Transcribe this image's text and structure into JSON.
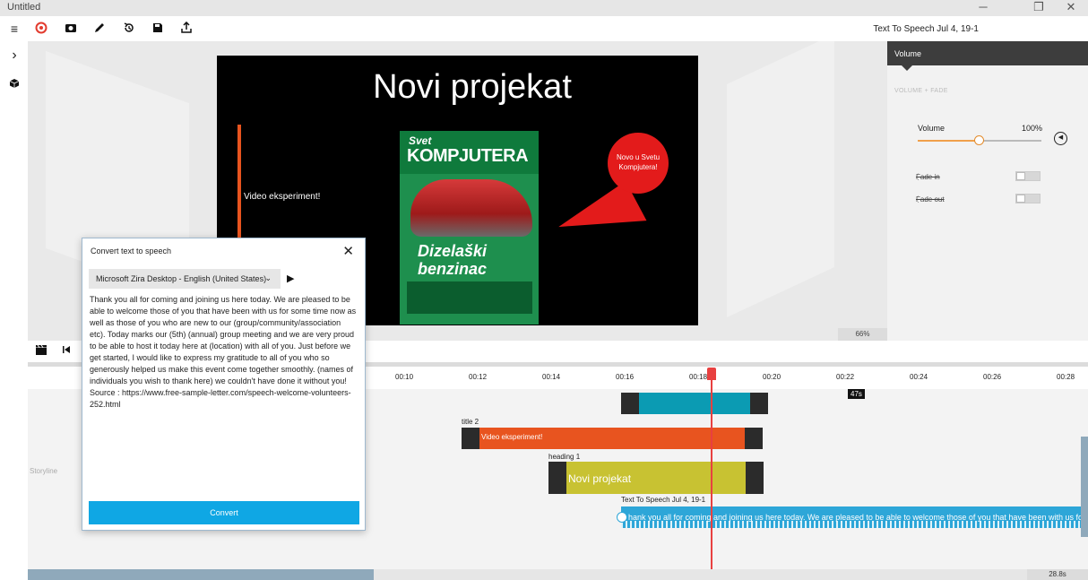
{
  "window": {
    "title": "Untitled",
    "minimize_glyph": "─",
    "restore_glyph": "❐",
    "close_glyph": "✕"
  },
  "toolbar": {
    "document_label": "Text To Speech Jul 4, 19-1",
    "icons": [
      "menu-icon",
      "record-icon",
      "camera-icon",
      "pen-icon",
      "history-icon",
      "save-icon",
      "export-icon"
    ]
  },
  "slide": {
    "title": "Novi projekat",
    "subtitle": "Video eksperiment!",
    "bubble_text": "Novo u Svetu Kompjutera!",
    "magazine": {
      "brand_small": "Svet",
      "brand_big": "KOMPJUTERA",
      "headline_1": "Dizelaški",
      "headline_2": "benzinac"
    },
    "zoom": "66%"
  },
  "properties": {
    "panel_title": "Volume",
    "section": "VOLUME + FADE",
    "volume_label": "Volume",
    "volume_value": "100%",
    "volume_level": 0.5,
    "fade_in_label": "Fade in",
    "fade_out_label": "Fade out"
  },
  "timeline": {
    "ticks": [
      "00:10",
      "00:12",
      "00:14",
      "00:16",
      "00:18",
      "00:20",
      "00:22",
      "00:24",
      "00:26",
      "00:28"
    ],
    "badge": "47s",
    "storyline_label": "Storyline",
    "clips": {
      "title2_label": "title 2",
      "title2_text": "Video eksperiment!",
      "heading1_label": "heading 1",
      "heading1_text": "Novi projekat",
      "tts_label": "Text To Speech Jul 4, 19-1",
      "tts_text": "hank you all for coming and joining us here today. We are pleased to be able to welcome those of you that have been with us for some time"
    },
    "duration": "28.8s"
  },
  "dialog": {
    "title": "Convert text to speech",
    "close_glyph": "✕",
    "voice": "Microsoft Zira Desktop - English (United States)",
    "text": "Thank you all for coming and joining us here today. We are pleased to be able to welcome those of you that have been with us for some time now as well as those of you who are new to our (group/community/association etc). Today marks our (5th) (annual) group meeting and we are very proud to be able to host it today here at (location) with all of you. Just before we get started, I would like to express my gratitude to all of you who so generously helped us make this event come together smoothly. (names of individuals you wish to thank here) we couldn't have done it without you!\nSource : https://www.free-sample-letter.com/speech-welcome-volunteers-252.html",
    "convert_label": "Convert"
  },
  "colors": {
    "accent_blue": "#0fa7e4",
    "orange_clip": "#e8541f",
    "yellow_clip": "#c8c232",
    "teal_clip": "#0b9bb3",
    "playhead": "#e84040"
  }
}
